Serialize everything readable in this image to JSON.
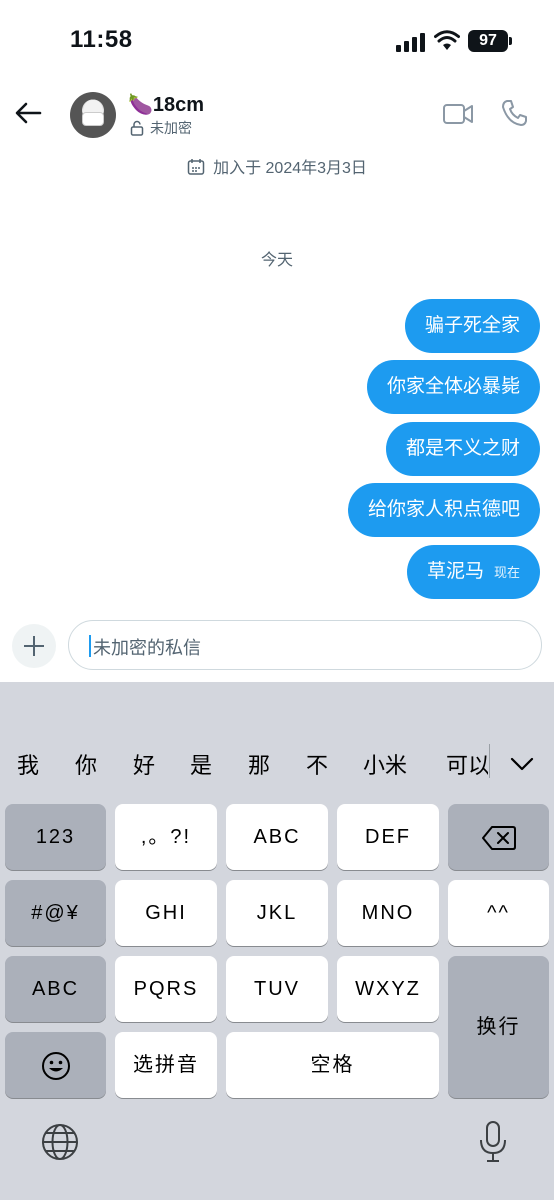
{
  "status_bar": {
    "time": "11:58",
    "battery": "97",
    "icons": [
      "signal-icon",
      "wifi-icon",
      "battery-icon"
    ]
  },
  "header": {
    "name": "🍆18cm",
    "encryption": "未加密",
    "joined": "加入于 2024年3月3日",
    "icons": [
      "back-arrow-icon",
      "video-camera-icon",
      "phone-icon",
      "lock-icon",
      "calendar-icon"
    ]
  },
  "conversation": {
    "day_label": "今天",
    "messages": [
      {
        "text": "骗子死全家",
        "timestamp": ""
      },
      {
        "text": "你家全体必暴毙",
        "timestamp": ""
      },
      {
        "text": "都是不义之财",
        "timestamp": ""
      },
      {
        "text": "给你家人积点德吧",
        "timestamp": ""
      },
      {
        "text": "草泥马",
        "timestamp": "现在"
      }
    ]
  },
  "composer": {
    "placeholder": "未加密的私信"
  },
  "keyboard": {
    "suggestions": [
      "我",
      "你",
      "好",
      "是",
      "那",
      "不",
      "小米",
      "可以"
    ],
    "rows": [
      [
        "123",
        ",。?!",
        "ABC",
        "DEF",
        "backspace"
      ],
      [
        "#@¥",
        "GHI",
        "JKL",
        "MNO",
        "^^"
      ],
      [
        "ABC",
        "PQRS",
        "TUV",
        "WXYZ",
        "换行"
      ],
      [
        "emoji",
        "选拼音",
        "空格"
      ]
    ],
    "labels": {
      "k123": "123",
      "punct": ",。?!",
      "abc2": "ABC",
      "def": "DEF",
      "symbols": "#@¥",
      "ghi": "GHI",
      "jkl": "JKL",
      "mno": "MNO",
      "face": "^^",
      "abc_switch": "ABC",
      "pqrs": "PQRS",
      "tuv": "TUV",
      "wxyz": "WXYZ",
      "return": "换行",
      "pinyin": "选拼音",
      "space": "空格"
    },
    "accent": "#1d9bf0",
    "background": "#d3d6dd"
  },
  "colors": {
    "bubble": "#1d9bf0",
    "secondary_text": "#536471"
  }
}
